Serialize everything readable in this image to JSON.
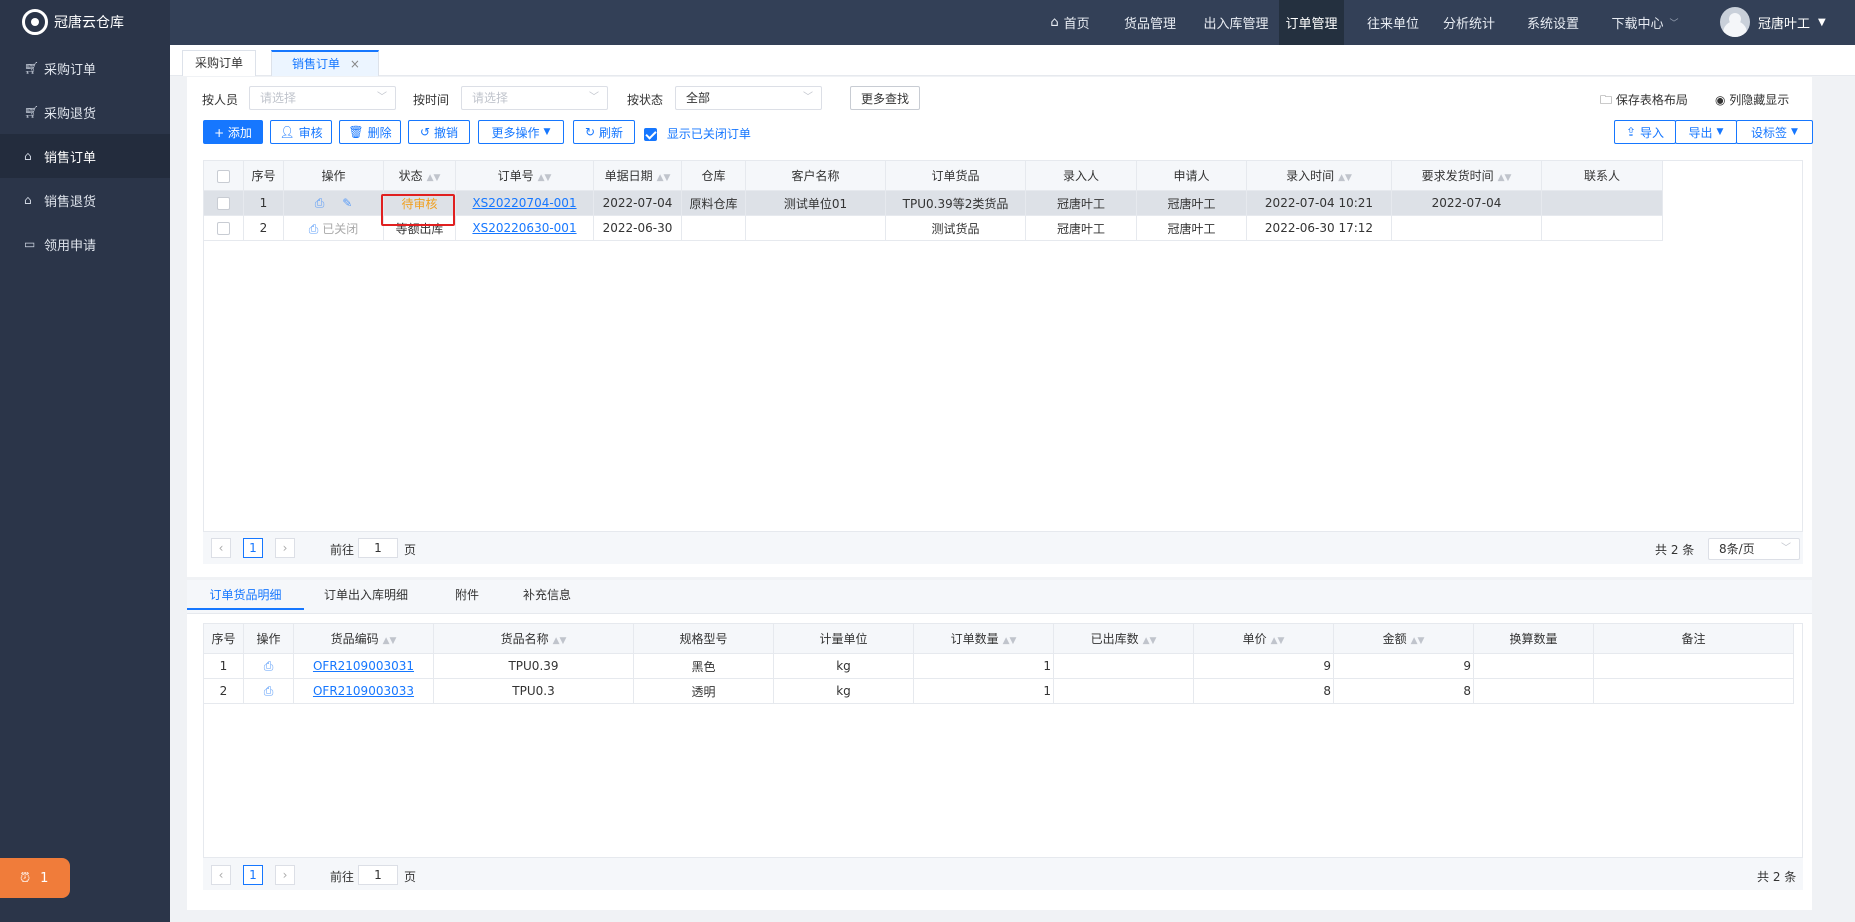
{
  "app": {
    "title": "冠唐云仓库"
  },
  "sidebar": {
    "items": [
      {
        "label": "采购订单",
        "icon": "cart-icon"
      },
      {
        "label": "采购退货",
        "icon": "cart-icon"
      },
      {
        "label": "销售订单",
        "icon": "bag-icon"
      },
      {
        "label": "销售退货",
        "icon": "bag-icon"
      },
      {
        "label": "领用申请",
        "icon": "briefcase-icon"
      }
    ]
  },
  "nav": {
    "items": [
      "首页",
      "货品管理",
      "出入库管理",
      "订单管理",
      "往来单位",
      "分析统计",
      "系统设置",
      "下载中心"
    ],
    "active": "订单管理"
  },
  "user": {
    "name": "冠唐叶工"
  },
  "page_tabs": [
    {
      "label": "采购订单"
    },
    {
      "label": "销售订单",
      "close": "×"
    }
  ],
  "filters": {
    "person_label": "按人员",
    "person_placeholder": "请选择",
    "time_label": "按时间",
    "time_placeholder": "请选择",
    "status_label": "按状态",
    "status_value": "全部",
    "more_search": "更多查找",
    "save_layout": "保存表格布局",
    "column_toggle": "列隐藏显示"
  },
  "toolbar": {
    "add": "+ 添加",
    "approve": "审核",
    "delete": "删除",
    "revoke": "撤销",
    "more_ops": "更多操作",
    "refresh": "刷新",
    "show_closed": "显示已关闭订单",
    "import": "导入",
    "export": "导出",
    "set_tag": "设标签"
  },
  "orders": {
    "columns": [
      "序号",
      "操作",
      "状态",
      "订单号",
      "单据日期",
      "仓库",
      "客户名称",
      "订单货品",
      "录入人",
      "申请人",
      "录入时间",
      "要求发货时间",
      "联系人"
    ],
    "rows": [
      {
        "idx": "1",
        "status": "待审核",
        "order_no": "XS20220704-001",
        "date": "2022-07-04",
        "warehouse": "原料仓库",
        "customer": "测试单位01",
        "goods": "TPU0.39等2类货品",
        "entry": "冠唐叶工",
        "applicant": "冠唐叶工",
        "entry_time": "2022-07-04 10:21",
        "ship_time": "2022-07-04",
        "contact": ""
      },
      {
        "idx": "2",
        "op_text": "已关闭",
        "status": "等额出库",
        "order_no": "XS20220630-001",
        "date": "2022-06-30",
        "warehouse": "",
        "customer": "",
        "goods": "测试货品",
        "entry": "冠唐叶工",
        "applicant": "冠唐叶工",
        "entry_time": "2022-06-30 17:12",
        "ship_time": "",
        "contact": ""
      }
    ],
    "pager": {
      "page": "1",
      "goto_prefix": "前往",
      "goto_value": "1",
      "goto_suffix": "页",
      "total": "共 2 条",
      "page_size": "8条/页"
    }
  },
  "detail": {
    "tabs": [
      "订单货品明细",
      "订单出入库明细",
      "附件",
      "补充信息"
    ],
    "columns": [
      "序号",
      "操作",
      "货品编码",
      "货品名称",
      "规格型号",
      "计量单位",
      "订单数量",
      "已出库数",
      "单价",
      "金额",
      "换算数量",
      "备注"
    ],
    "rows": [
      {
        "idx": "1",
        "code": "OFR2109003031",
        "name": "TPU0.39",
        "spec": "黑色",
        "unit": "kg",
        "qty": "1",
        "out": "",
        "price": "9",
        "amount": "9",
        "conv": "",
        "note": ""
      },
      {
        "idx": "2",
        "code": "OFR2109003033",
        "name": "TPU0.3",
        "spec": "透明",
        "unit": "kg",
        "qty": "1",
        "out": "",
        "price": "8",
        "amount": "8",
        "conv": "",
        "note": ""
      }
    ],
    "pager": {
      "page": "1",
      "goto_prefix": "前往",
      "goto_value": "1",
      "goto_suffix": "页",
      "total": "共 2 条"
    }
  },
  "alarm": {
    "count": "1"
  },
  "colors": {
    "sidebar": "#2b3549",
    "topbar": "#334057",
    "accent": "#1677ff",
    "pending": "#f0a020",
    "highlight": "#e02020"
  }
}
